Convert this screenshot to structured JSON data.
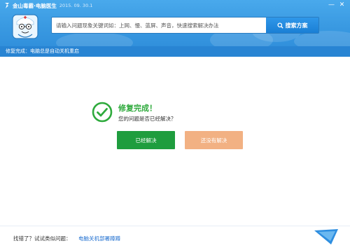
{
  "app": {
    "title": "金山毒霸·电脑医生",
    "date": "2015. 09. 30.1",
    "logo_icon": "kingsoft-logo-icon"
  },
  "window_controls": {
    "minimize": "—",
    "close": "✕"
  },
  "search": {
    "placeholder": "请输入问题现象关键词如：上网、慢、蓝屏、声音，快速搜索解决办法",
    "value": "",
    "button_label": "搜索方案",
    "button_icon": "search-icon"
  },
  "status_bar": {
    "text": "修复完成：电脑总是自动关机重启"
  },
  "result": {
    "title": "修复完成！",
    "question": "您的问题是否已经解决？",
    "solved_button": "已经解决",
    "unsolved_button": "还没有解决",
    "icon": "checkmark-circle-icon"
  },
  "footer": {
    "label": "找错了？试试类似问题：",
    "link": "电脑关机部署蹲蹲"
  },
  "colors": {
    "header_blue": "#3a9ae2",
    "status_bar_blue": "#2884d3",
    "success_green": "#2eaa3c",
    "solved_button": "#1f9d3e",
    "unsolved_button": "#f2b183",
    "link_blue": "#1f6fd0"
  }
}
